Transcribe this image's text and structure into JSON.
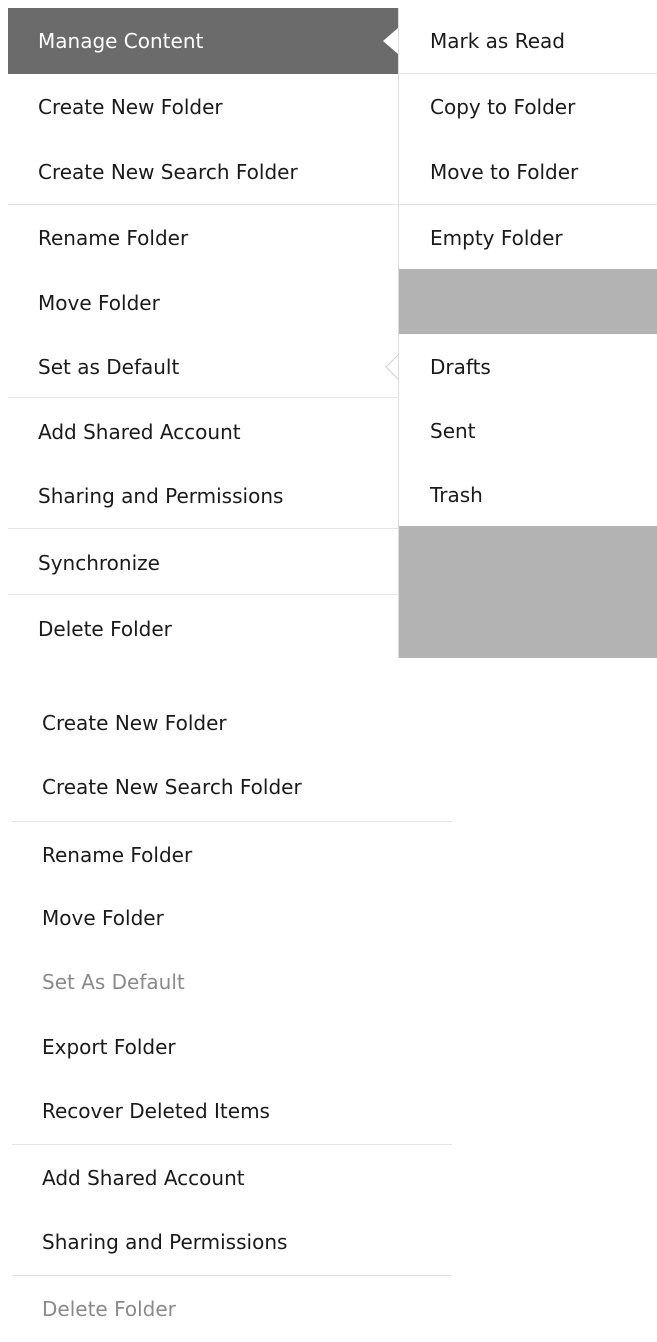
{
  "main_menu": {
    "items": [
      {
        "label": "Manage Content",
        "state": "active"
      },
      {
        "label": "Create New Folder"
      },
      {
        "label": "Create New Search Folder"
      },
      {
        "label": "Rename Folder"
      },
      {
        "label": "Move Folder"
      },
      {
        "label": "Set as Default"
      },
      {
        "label": "Add Shared Account"
      },
      {
        "label": "Sharing and Permissions"
      },
      {
        "label": "Synchronize"
      },
      {
        "label": "Delete Folder"
      }
    ]
  },
  "manage_content_submenu": {
    "items": [
      {
        "label": "Mark as Read"
      },
      {
        "label": "Copy to Folder"
      },
      {
        "label": "Move to Folder"
      },
      {
        "label": "Empty Folder"
      }
    ]
  },
  "set_default_submenu": {
    "items": [
      {
        "label": "Drafts"
      },
      {
        "label": "Sent"
      },
      {
        "label": "Trash"
      }
    ]
  },
  "bottom_menu": {
    "items": [
      {
        "label": "Create New Folder"
      },
      {
        "label": "Create New Search Folder"
      },
      {
        "label": "Rename Folder"
      },
      {
        "label": "Move Folder"
      },
      {
        "label": "Set As Default",
        "state": "disabled"
      },
      {
        "label": "Export Folder"
      },
      {
        "label": "Recover Deleted Items"
      },
      {
        "label": "Add Shared Account"
      },
      {
        "label": "Sharing and Permissions"
      },
      {
        "label": "Delete Folder",
        "state": "disabled"
      }
    ]
  },
  "colors": {
    "active_bg": "#6b6b6b",
    "submenu_filler": "#b3b3b3",
    "separator": "#e4e4e4",
    "disabled_text": "#8a8a8a"
  }
}
